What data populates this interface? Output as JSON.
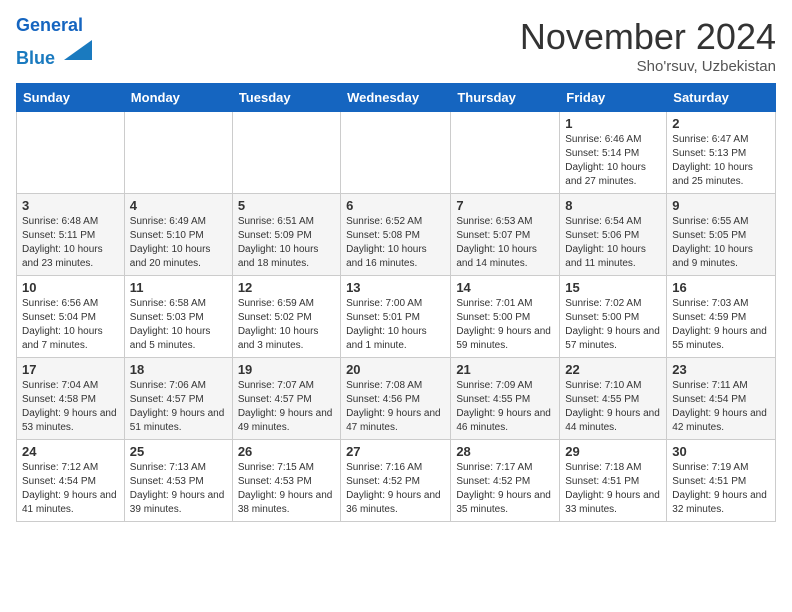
{
  "header": {
    "logo_line1": "General",
    "logo_line2": "Blue",
    "month": "November 2024",
    "location": "Sho'rsuv, Uzbekistan"
  },
  "days_of_week": [
    "Sunday",
    "Monday",
    "Tuesday",
    "Wednesday",
    "Thursday",
    "Friday",
    "Saturday"
  ],
  "weeks": [
    [
      {
        "day": "",
        "info": ""
      },
      {
        "day": "",
        "info": ""
      },
      {
        "day": "",
        "info": ""
      },
      {
        "day": "",
        "info": ""
      },
      {
        "day": "",
        "info": ""
      },
      {
        "day": "1",
        "info": "Sunrise: 6:46 AM\nSunset: 5:14 PM\nDaylight: 10 hours and 27 minutes."
      },
      {
        "day": "2",
        "info": "Sunrise: 6:47 AM\nSunset: 5:13 PM\nDaylight: 10 hours and 25 minutes."
      }
    ],
    [
      {
        "day": "3",
        "info": "Sunrise: 6:48 AM\nSunset: 5:11 PM\nDaylight: 10 hours and 23 minutes."
      },
      {
        "day": "4",
        "info": "Sunrise: 6:49 AM\nSunset: 5:10 PM\nDaylight: 10 hours and 20 minutes."
      },
      {
        "day": "5",
        "info": "Sunrise: 6:51 AM\nSunset: 5:09 PM\nDaylight: 10 hours and 18 minutes."
      },
      {
        "day": "6",
        "info": "Sunrise: 6:52 AM\nSunset: 5:08 PM\nDaylight: 10 hours and 16 minutes."
      },
      {
        "day": "7",
        "info": "Sunrise: 6:53 AM\nSunset: 5:07 PM\nDaylight: 10 hours and 14 minutes."
      },
      {
        "day": "8",
        "info": "Sunrise: 6:54 AM\nSunset: 5:06 PM\nDaylight: 10 hours and 11 minutes."
      },
      {
        "day": "9",
        "info": "Sunrise: 6:55 AM\nSunset: 5:05 PM\nDaylight: 10 hours and 9 minutes."
      }
    ],
    [
      {
        "day": "10",
        "info": "Sunrise: 6:56 AM\nSunset: 5:04 PM\nDaylight: 10 hours and 7 minutes."
      },
      {
        "day": "11",
        "info": "Sunrise: 6:58 AM\nSunset: 5:03 PM\nDaylight: 10 hours and 5 minutes."
      },
      {
        "day": "12",
        "info": "Sunrise: 6:59 AM\nSunset: 5:02 PM\nDaylight: 10 hours and 3 minutes."
      },
      {
        "day": "13",
        "info": "Sunrise: 7:00 AM\nSunset: 5:01 PM\nDaylight: 10 hours and 1 minute."
      },
      {
        "day": "14",
        "info": "Sunrise: 7:01 AM\nSunset: 5:00 PM\nDaylight: 9 hours and 59 minutes."
      },
      {
        "day": "15",
        "info": "Sunrise: 7:02 AM\nSunset: 5:00 PM\nDaylight: 9 hours and 57 minutes."
      },
      {
        "day": "16",
        "info": "Sunrise: 7:03 AM\nSunset: 4:59 PM\nDaylight: 9 hours and 55 minutes."
      }
    ],
    [
      {
        "day": "17",
        "info": "Sunrise: 7:04 AM\nSunset: 4:58 PM\nDaylight: 9 hours and 53 minutes."
      },
      {
        "day": "18",
        "info": "Sunrise: 7:06 AM\nSunset: 4:57 PM\nDaylight: 9 hours and 51 minutes."
      },
      {
        "day": "19",
        "info": "Sunrise: 7:07 AM\nSunset: 4:57 PM\nDaylight: 9 hours and 49 minutes."
      },
      {
        "day": "20",
        "info": "Sunrise: 7:08 AM\nSunset: 4:56 PM\nDaylight: 9 hours and 47 minutes."
      },
      {
        "day": "21",
        "info": "Sunrise: 7:09 AM\nSunset: 4:55 PM\nDaylight: 9 hours and 46 minutes."
      },
      {
        "day": "22",
        "info": "Sunrise: 7:10 AM\nSunset: 4:55 PM\nDaylight: 9 hours and 44 minutes."
      },
      {
        "day": "23",
        "info": "Sunrise: 7:11 AM\nSunset: 4:54 PM\nDaylight: 9 hours and 42 minutes."
      }
    ],
    [
      {
        "day": "24",
        "info": "Sunrise: 7:12 AM\nSunset: 4:54 PM\nDaylight: 9 hours and 41 minutes."
      },
      {
        "day": "25",
        "info": "Sunrise: 7:13 AM\nSunset: 4:53 PM\nDaylight: 9 hours and 39 minutes."
      },
      {
        "day": "26",
        "info": "Sunrise: 7:15 AM\nSunset: 4:53 PM\nDaylight: 9 hours and 38 minutes."
      },
      {
        "day": "27",
        "info": "Sunrise: 7:16 AM\nSunset: 4:52 PM\nDaylight: 9 hours and 36 minutes."
      },
      {
        "day": "28",
        "info": "Sunrise: 7:17 AM\nSunset: 4:52 PM\nDaylight: 9 hours and 35 minutes."
      },
      {
        "day": "29",
        "info": "Sunrise: 7:18 AM\nSunset: 4:51 PM\nDaylight: 9 hours and 33 minutes."
      },
      {
        "day": "30",
        "info": "Sunrise: 7:19 AM\nSunset: 4:51 PM\nDaylight: 9 hours and 32 minutes."
      }
    ]
  ]
}
